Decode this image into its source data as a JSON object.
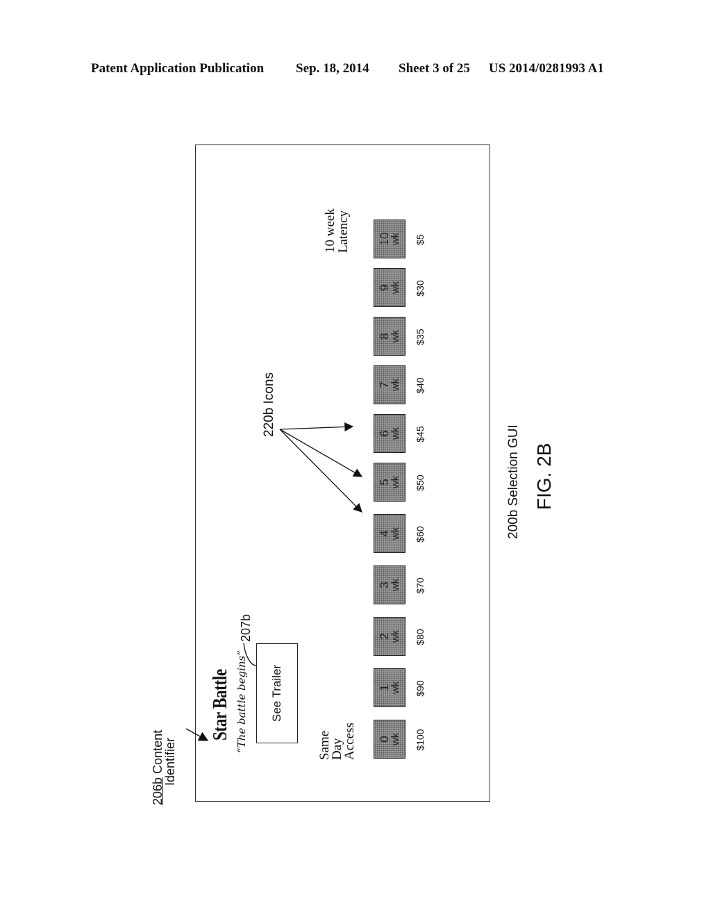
{
  "header": {
    "publication": "Patent Application Publication",
    "date": "Sep. 18, 2014",
    "sheet": "Sheet 3 of 25",
    "number": "US 2014/0281993 A1"
  },
  "figure": {
    "label": "FIG. 2B",
    "gui_ref": "200b Selection GUI",
    "content_identifier_ref_num": "206b",
    "content_identifier_ref_text": " Content",
    "content_identifier_ref_text2": "Identifier",
    "trailer_ref": "207b",
    "icons_ref": "220b Icons"
  },
  "gui": {
    "title": "Star Battle",
    "tagline": "“The battle begins”",
    "trailer_button": "See Trailer",
    "left_label": [
      "Same",
      "Day",
      "Access"
    ],
    "right_label": [
      "10 week",
      "Latency"
    ],
    "icons": [
      {
        "num": "0",
        "unit": "wk",
        "price": "$100"
      },
      {
        "num": "1",
        "unit": "wk",
        "price": "$90"
      },
      {
        "num": "2",
        "unit": "wk",
        "price": "$80"
      },
      {
        "num": "3",
        "unit": "wk",
        "price": "$70"
      },
      {
        "num": "4",
        "unit": "wk",
        "price": "$60"
      },
      {
        "num": "5",
        "unit": "wk",
        "price": "$50"
      },
      {
        "num": "6",
        "unit": "wk",
        "price": "$45"
      },
      {
        "num": "7",
        "unit": "wk",
        "price": "$40"
      },
      {
        "num": "8",
        "unit": "wk",
        "price": "$35"
      },
      {
        "num": "9",
        "unit": "wk",
        "price": "$30"
      },
      {
        "num": "10",
        "unit": "wk",
        "price": "$5"
      }
    ]
  }
}
